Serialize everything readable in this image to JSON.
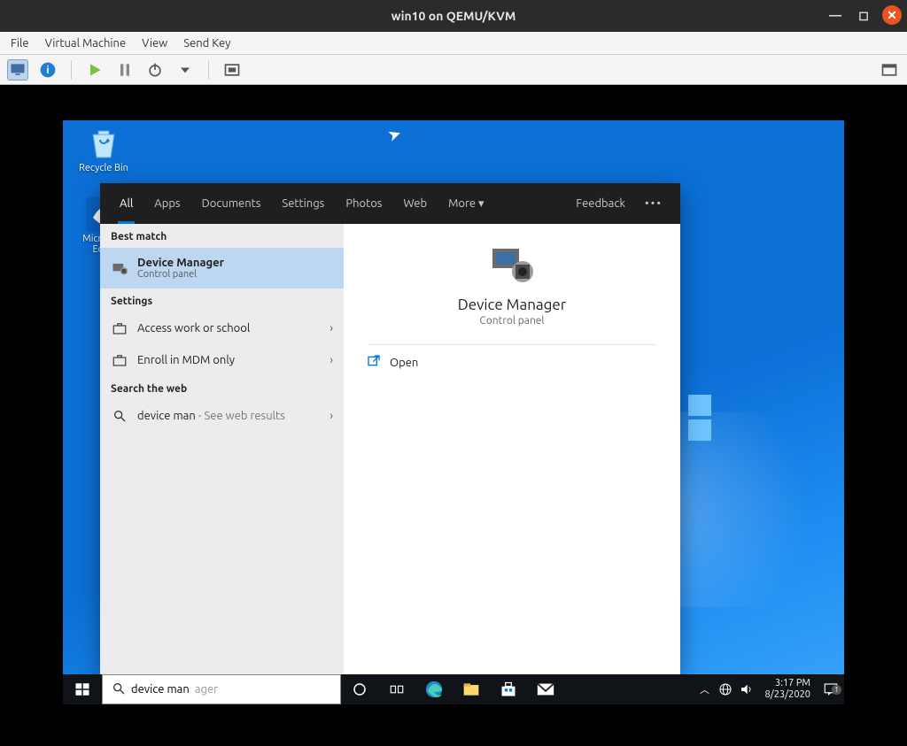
{
  "host": {
    "title": "win10 on QEMU/KVM",
    "menu": {
      "file": "File",
      "vm": "Virtual Machine",
      "view": "View",
      "sendkey": "Send Key"
    }
  },
  "desktop": {
    "recycle_bin": "Recycle Bin",
    "edge": "Microsoft Edge"
  },
  "search_popup": {
    "tabs": {
      "all": "All",
      "apps": "Apps",
      "documents": "Documents",
      "settings": "Settings",
      "photos": "Photos",
      "web": "Web",
      "more": "More",
      "feedback": "Feedback"
    },
    "best_match_hd": "Best match",
    "best_match": {
      "title": "Device Manager",
      "sub": "Control panel"
    },
    "settings_hd": "Settings",
    "settings_items": [
      {
        "label": "Access work or school"
      },
      {
        "label": "Enroll in MDM only"
      }
    ],
    "web_hd": "Search the web",
    "web_item": {
      "query": "device man",
      "suffix": " - See web results"
    },
    "preview": {
      "title": "Device Manager",
      "sub": "Control panel",
      "open": "Open"
    }
  },
  "taskbar": {
    "search_typed": "device man",
    "search_ghost": "ager",
    "clock": {
      "time": "3:17 PM",
      "date": "8/23/2020"
    },
    "notif_count": "1"
  }
}
